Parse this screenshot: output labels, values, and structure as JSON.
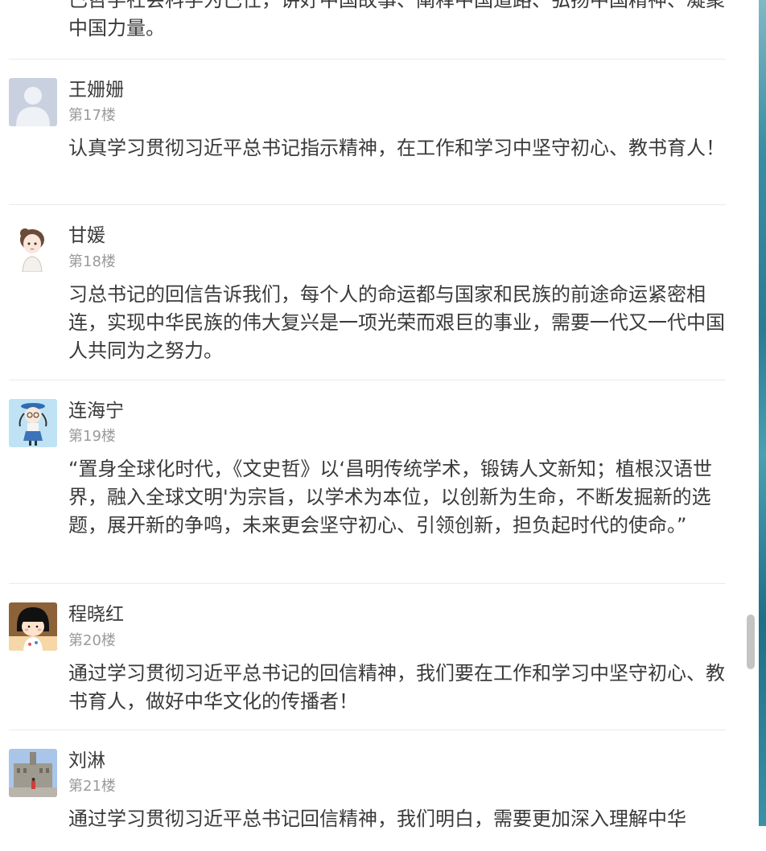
{
  "top_partial": {
    "text": "已哲学社会科学为己任，讲好中国故事、阐释中国道路、弘扬中国精神、凝聚中国力量。"
  },
  "comments": [
    {
      "name": "王姗姗",
      "floor": "第17楼",
      "avatar": "default-user-avatar",
      "text": "认真学习贯彻习近平总书记指示精神，在工作和学习中坚守初心、教书育人！"
    },
    {
      "name": "甘媛",
      "floor": "第18楼",
      "avatar": "cartoon-girl-avatar",
      "text": "习总书记的回信告诉我们，每个人的命运都与国家和民族的前途命运紧密相连，实现中华民族的伟大复兴是一项光荣而艰巨的事业，需要一代又一代中国人共同为之努力。"
    },
    {
      "name": "连海宁",
      "floor": "第19楼",
      "avatar": "cartoon-braids-girl-avatar",
      "text": "“置身全球化时代，《文史哲》以‘昌明传统学术，锻铸人文新知；植根汉语世界，融入全球文明'为宗旨，以学术为本位，以创新为生命，不断发掘新的选题，展开新的争鸣，未来更会坚守初心、引领创新，担负起时代的使命。”"
    },
    {
      "name": "程晓红",
      "floor": "第20楼",
      "avatar": "maruko-avatar",
      "text": "通过学习贯彻习近平总书记的回信精神，我们要在工作和学习中坚守初心、教书育人，做好中华文化的传播者！"
    },
    {
      "name": "刘淋",
      "floor": "第21楼",
      "avatar": "photo-building-avatar",
      "text": "通过学习贯彻习近平总书记回信精神，我们明白，需要更加深入理解中华"
    }
  ]
}
